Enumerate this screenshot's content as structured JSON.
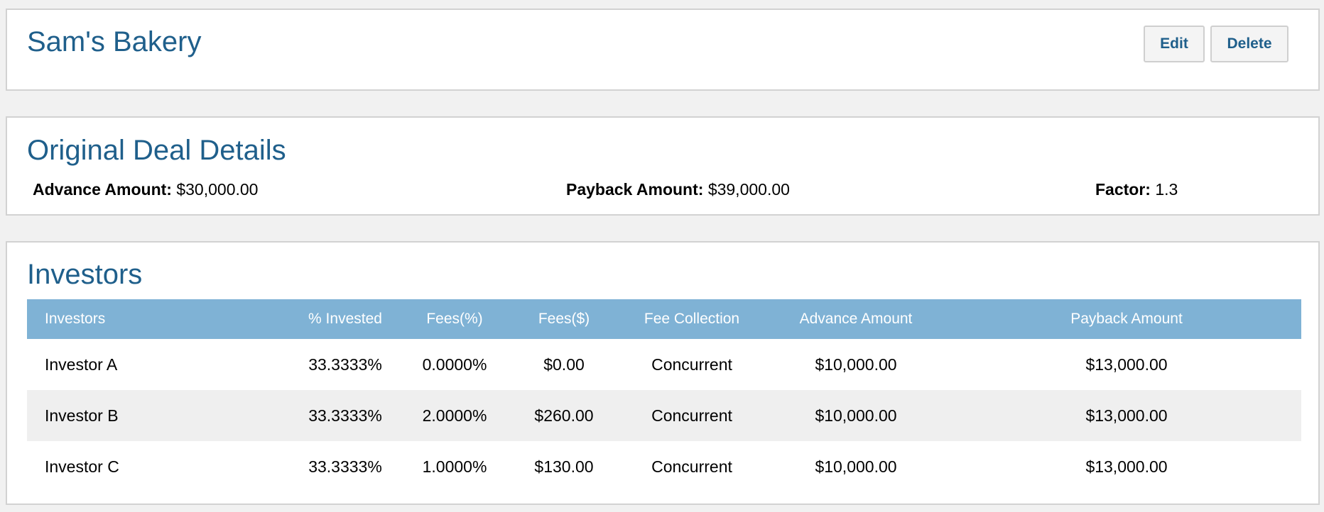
{
  "header": {
    "title": "Sam's Bakery",
    "edit_label": "Edit",
    "delete_label": "Delete"
  },
  "deal": {
    "title": "Original Deal Details",
    "advance_label": "Advance Amount:",
    "advance_value": "$30,000.00",
    "payback_label": "Payback Amount:",
    "payback_value": "$39,000.00",
    "factor_label": "Factor:",
    "factor_value": "1.3"
  },
  "investors": {
    "title": "Investors",
    "columns": [
      "Investors",
      "% Invested",
      "Fees(%)",
      "Fees($)",
      "Fee Collection",
      "Advance Amount",
      "Payback Amount"
    ],
    "rows": [
      [
        "Investor A",
        "33.3333%",
        "0.0000%",
        "$0.00",
        "Concurrent",
        "$10,000.00",
        "$13,000.00"
      ],
      [
        "Investor B",
        "33.3333%",
        "2.0000%",
        "$260.00",
        "Concurrent",
        "$10,000.00",
        "$13,000.00"
      ],
      [
        "Investor C",
        "33.3333%",
        "1.0000%",
        "$130.00",
        "Concurrent",
        "$10,000.00",
        "$13,000.00"
      ]
    ]
  },
  "colors": {
    "background": "#f1f1f1",
    "panel": "#ffffff",
    "title": "#1f5f8b",
    "table_header": "#7fb2d5",
    "row_alt": "#efefef"
  }
}
